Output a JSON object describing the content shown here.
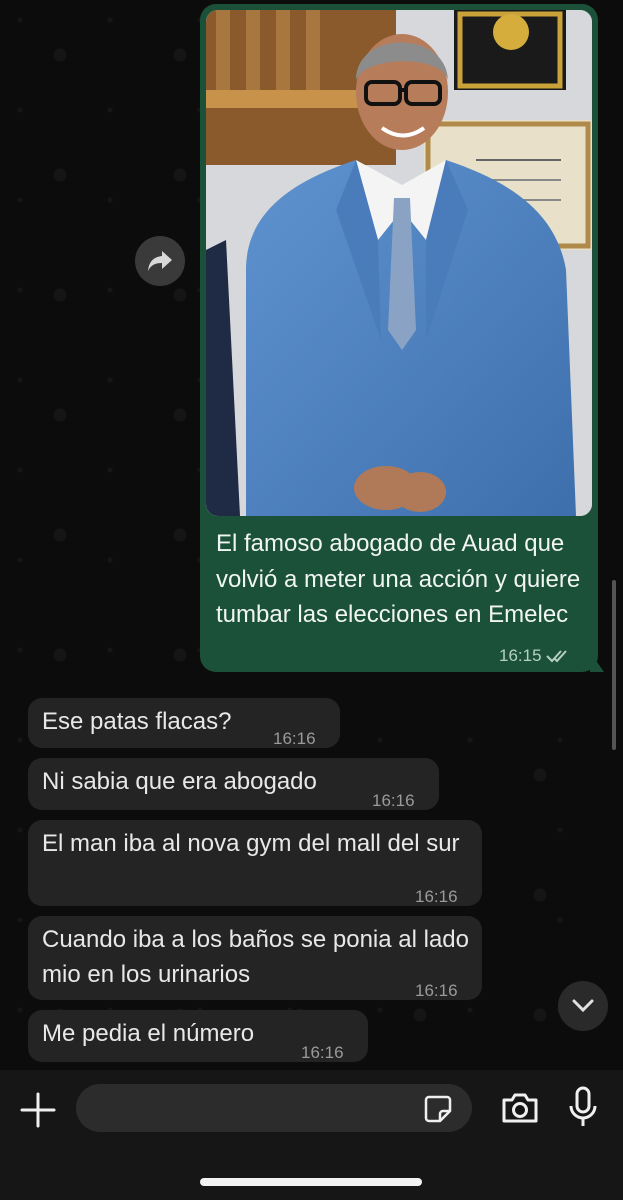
{
  "outgoing": {
    "photo_alt": "Foto de hombre con traje azul",
    "text": "El famoso abogado de Auad que volvió a meter una acción y quiere tumbar las elecciones en Emelec",
    "time": "16:15",
    "status_icon": "double-check-icon"
  },
  "incoming": [
    {
      "text": "Ese patas flacas?",
      "time": "16:16"
    },
    {
      "text": "Ni sabia que era abogado",
      "time": "16:16"
    },
    {
      "text": "El man iba al nova gym del mall del sur",
      "time": "16:16"
    },
    {
      "text": "Cuando iba a los baños se ponia al lado mio en los urinarios",
      "time": "16:16"
    },
    {
      "text": "Me pedia el número",
      "time": "16:16"
    }
  ],
  "input": {
    "placeholder": "",
    "value": ""
  },
  "icons": {
    "forward": "forward-icon",
    "scroll_down": "chevron-down-icon",
    "attach": "plus-icon",
    "sticker": "sticker-icon",
    "camera": "camera-icon",
    "mic": "microphone-icon"
  },
  "colors": {
    "outgoing_bubble": "#1b5138",
    "incoming_bubble": "#242424",
    "background": "#0c0c0c"
  }
}
